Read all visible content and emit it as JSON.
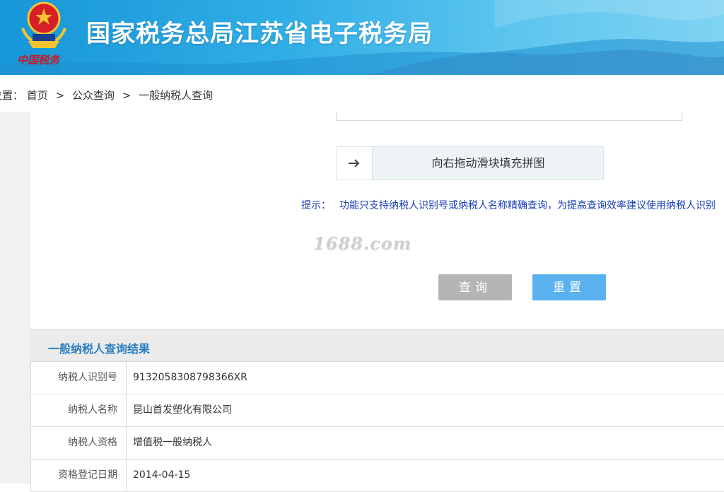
{
  "header": {
    "title": "国家税务总局江苏省电子税务局",
    "emblem_text": "中国税务"
  },
  "breadcrumb": {
    "prefix": "位置：",
    "items": [
      "首页",
      "公众查询",
      "一般纳税人查询"
    ],
    "separator": ">"
  },
  "form": {
    "slider_text": "向右拖动滑块填充拼图",
    "tip_label": "提示：",
    "tip_text": "功能只支持纳税人识别号或纳税人名称精确查询，为提高查询效率建议使用纳税人识别",
    "query_button": "查询",
    "reset_button": "重置"
  },
  "watermark": "1688.com",
  "result": {
    "title": "一般纳税人查询结果",
    "rows": [
      {
        "label": "纳税人识别号",
        "value": "9132058308798366XR"
      },
      {
        "label": "纳税人名称",
        "value": "昆山首发塑化有限公司"
      },
      {
        "label": "纳税人资格",
        "value": "增值税一般纳税人"
      },
      {
        "label": "资格登记日期",
        "value": "2014-04-15"
      }
    ]
  },
  "colors": {
    "banner": "#1796d8",
    "title_blue": "#2a7fc1",
    "tip_blue": "#1a3fb8",
    "query_btn": "#b5b5b5",
    "reset_btn": "#5ab1ef"
  }
}
